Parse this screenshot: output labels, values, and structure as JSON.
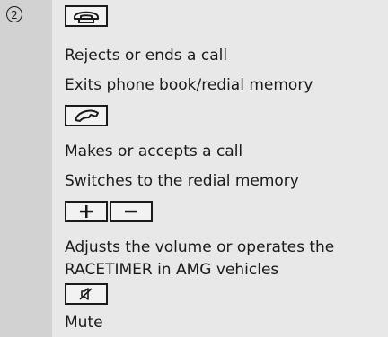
{
  "step_marker": "2",
  "keys": [
    {
      "icon": "end-call-icon"
    },
    {
      "icon": "accept-call-icon"
    },
    {
      "icon": "volume-up-icon",
      "label": "+"
    },
    {
      "icon": "volume-down-icon",
      "label": "−"
    },
    {
      "icon": "mute-icon"
    }
  ],
  "lines": {
    "end_1": "Rejects or ends a call",
    "end_2": "Exits phone book/redial memory",
    "accept_1": "Makes or accepts a call",
    "accept_2": "Switches to the redial memory",
    "volume_1": "Adjusts the volume or operates the",
    "volume_2": "RACETIMER in AMG vehicles",
    "mute_1": "Mute"
  }
}
